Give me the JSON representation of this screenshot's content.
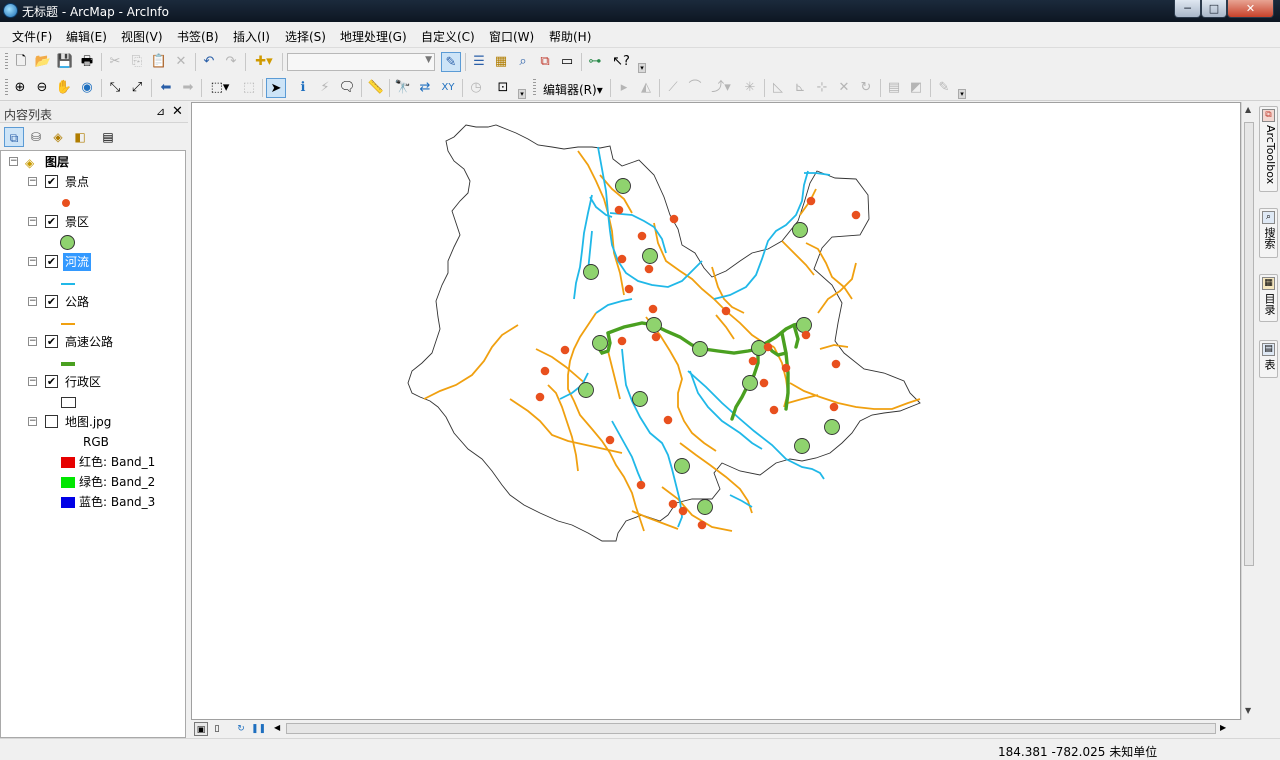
{
  "window": {
    "title": "无标题 - ArcMap - ArcInfo",
    "min_label": "─",
    "max_label": "□",
    "close_label": "✕"
  },
  "menu": [
    {
      "label": "文件(F)"
    },
    {
      "label": "编辑(E)"
    },
    {
      "label": "视图(V)"
    },
    {
      "label": "书签(B)"
    },
    {
      "label": "插入(I)"
    },
    {
      "label": "选择(S)"
    },
    {
      "label": "地理处理(G)"
    },
    {
      "label": "自定义(C)"
    },
    {
      "label": "窗口(W)"
    },
    {
      "label": "帮助(H)"
    }
  ],
  "toolbar": {
    "scale_value": "",
    "editor_label": "编辑器(R)",
    "editor_arrow": "▾"
  },
  "toc": {
    "title": "内容列表",
    "pin": "⊿",
    "close": "✕",
    "root_label": "图层",
    "layers": [
      {
        "label": "景点",
        "checked": "✔"
      },
      {
        "label": "景区",
        "checked": "✔"
      },
      {
        "label": "河流",
        "checked": "✔"
      },
      {
        "label": "公路",
        "checked": "✔"
      },
      {
        "label": "高速公路",
        "checked": "✔"
      },
      {
        "label": "行政区",
        "checked": "✔"
      },
      {
        "label": "地图.jpg",
        "checked": ""
      }
    ],
    "raster": {
      "mode": "RGB",
      "bands": [
        {
          "label": "红色:    Band_1",
          "color": "#e60000"
        },
        {
          "label": "绿色: Band_2",
          "color": "#00e600"
        },
        {
          "label": "蓝色:    Band_3",
          "color": "#0000e6"
        }
      ]
    }
  },
  "legend_colors": {
    "scenic_point": "#e8501e",
    "scenic_area": "#8fd36e",
    "river": "#20b8e8",
    "road": "#f0a010",
    "highway": "#4aa020",
    "boundary": "#333333"
  },
  "right_dock": [
    {
      "label": "ArcToolbox"
    },
    {
      "label": "搜索"
    },
    {
      "label": "目录"
    },
    {
      "label": "表"
    }
  ],
  "status": {
    "coordinates": "184.381  -782.025 未知单位"
  }
}
